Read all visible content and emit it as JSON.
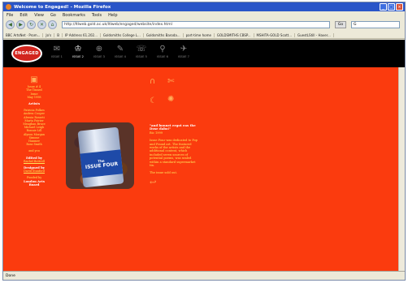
{
  "browser": {
    "title": "Welcome to Engaged! - Mozilla Firefox",
    "menu": [
      "File",
      "Edit",
      "View",
      "Go",
      "Bookmarks",
      "Tools",
      "Help"
    ],
    "url": "http://ltlweb.gold.ac.uk/ltlweb/engaged/website/index.html",
    "go_label": "Go",
    "search_placeholder": "G",
    "bookmarks": [
      "BBC ArtsNet · Prom...",
      "Jo's",
      "B",
      "IP Address 61.202...",
      "Goldsmiths College L...",
      "Goldsmiths Baroda...",
      "part-time home",
      "GOLDSMITHS CBSP...",
      "MSHITA-GOLD Scott...",
      "GuestLStill - Haver..."
    ],
    "status": "Done"
  },
  "site": {
    "logo": "ENGAGED",
    "issues": [
      {
        "label": "ISSUE 1",
        "glyph": "✉"
      },
      {
        "label": "ISSUE 2",
        "glyph": "♔"
      },
      {
        "label": "ISSUE 3",
        "glyph": "⊕"
      },
      {
        "label": "ISSUE 4",
        "glyph": "✎"
      },
      {
        "label": "ISSUE 5",
        "glyph": "☏"
      },
      {
        "label": "ISSUE 6",
        "glyph": "⚲"
      },
      {
        "label": "ISSUE 7",
        "glyph": "✈"
      }
    ],
    "left": {
      "issue_line1": "Issue # 4",
      "issue_line2": "The Tinned",
      "issue_line3": "Issue",
      "issue_line4": "May 1998",
      "artists_heading": "Artists",
      "artists": [
        "Patricia Folkes",
        "Andrea Cooper",
        "Alessia Rosseti",
        "Marta Poirier",
        "Meaghan Bruce",
        "Michael Leigh",
        "Ronnie Lill",
        "Alyson Morgan",
        "Simone",
        "Hanmer",
        "Ross Smith"
      ],
      "and_you": "and you",
      "edited_by": "Edited by",
      "editor": "Rachel Bottrell",
      "designed_by": "Designed by",
      "designer": "David Stanford",
      "funded_by": "Funded by",
      "funder1": "London Arts",
      "funder2": "Board"
    },
    "photo": {
      "can_top": "The",
      "can_main": "ISSUE FOUR"
    },
    "right": {
      "quote": "\"and bonnet ergot eas the Dose dabo!\"",
      "quote_sub": "Bic 1999",
      "body": "Issue Four was dedicated to Pop and Found art. The featured works of the artists and the additional content, which included seven sources of potential poems, was sealed within a standard supermarket tin.",
      "soldout": "The issue sold out."
    }
  }
}
